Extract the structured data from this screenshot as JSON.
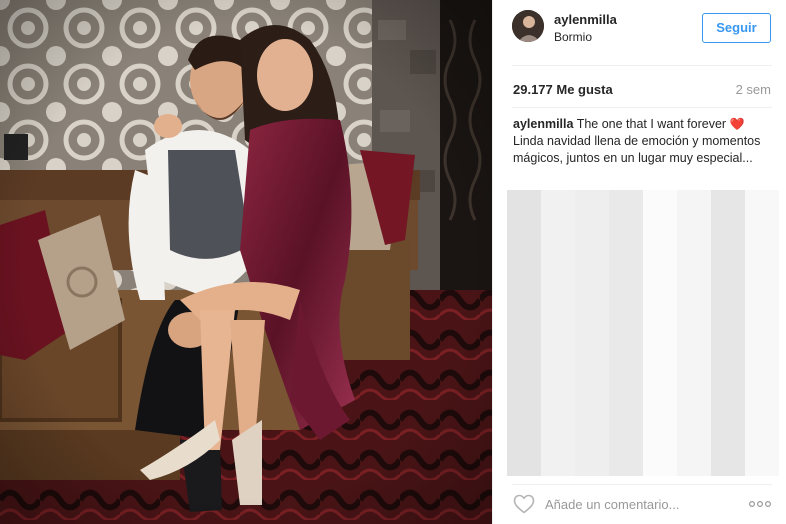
{
  "post": {
    "username": "aylenmilla",
    "location": "Bormio",
    "follow_label": "Seguir",
    "likes": "29.177 Me gusta",
    "time_ago": "2 sem",
    "caption": {
      "author": "aylenmilla",
      "text": " The one that I want forever ",
      "emoji": "❤️",
      "continued": " Linda navidad llena de emoción y momentos mágicos, juntos en un lugar muy especial..."
    },
    "comment_placeholder": "Añade un comentario...",
    "more_label": "..."
  },
  "colors": {
    "accent": "#3897f0",
    "text": "#262626",
    "muted": "#999999",
    "divider": "#efefef",
    "heart": "#e0245e"
  },
  "icons": {
    "like": "heart-outline-icon",
    "more": "ellipsis-icon"
  }
}
